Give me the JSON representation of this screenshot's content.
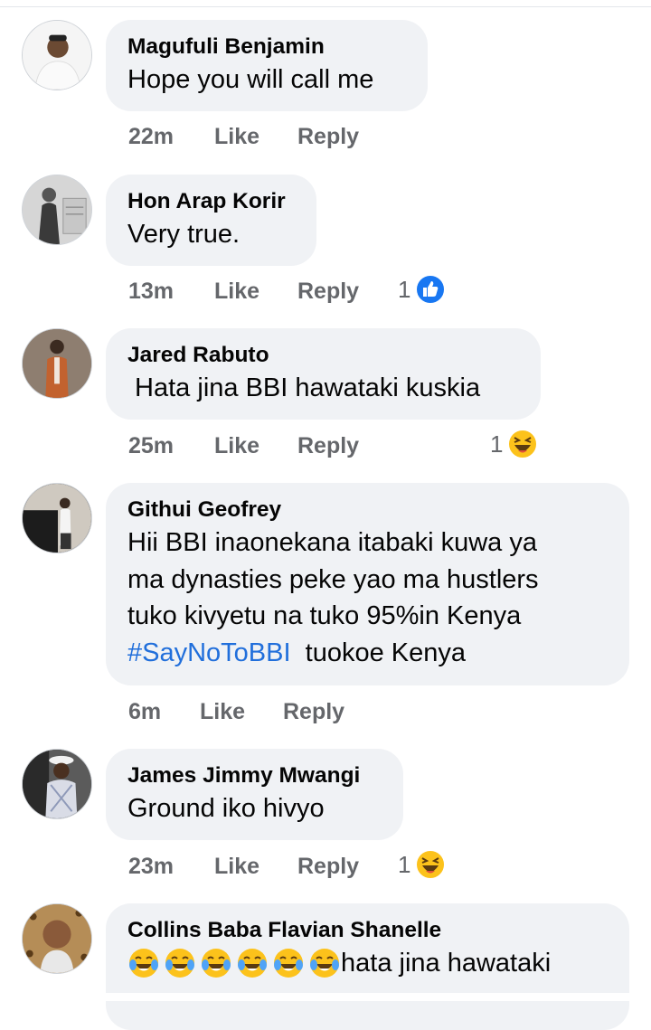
{
  "comments": [
    {
      "author": "Magufuli Benjamin",
      "text": "Hope you will call me",
      "time": "22m",
      "like": "Like",
      "reply": "Reply",
      "reaction_count": "",
      "reaction_icon": ""
    },
    {
      "author": "Hon Arap Korir",
      "text": "Very true.",
      "time": "13m",
      "like": "Like",
      "reply": "Reply",
      "reaction_count": "1",
      "reaction_icon": "like-reaction-icon"
    },
    {
      "author": "Jared Rabuto",
      "text": " Hata jina BBI hawataki kuskia",
      "time": "25m",
      "like": "Like",
      "reply": "Reply",
      "reaction_count": "1",
      "reaction_icon": "haha-reaction-icon"
    },
    {
      "author": "Githui Geofrey",
      "lines": [
        "Hii BBI inaonekana itabaki kuwa ya",
        "ma dynasties peke yao ma hustlers",
        "tuko kivyetu na tuko 95%in Kenya"
      ],
      "hashtag": "#SayNoToBBI",
      "after_hashtag": "  tuokoe Kenya",
      "time": "6m",
      "like": "Like",
      "reply": "Reply"
    },
    {
      "author": "James Jimmy Mwangi",
      "text": "Ground iko hivyo",
      "time": "23m",
      "like": "Like",
      "reply": "Reply",
      "reaction_count": "1",
      "reaction_icon": "haha-reaction-icon"
    },
    {
      "author": "Collins Baba Flavian Shanelle",
      "emoji_icon": "tears-of-joy-emoji",
      "emoji_repeat": 6,
      "text": "hata jina hawataki"
    }
  ],
  "colors": {
    "bubble": "#f0f2f5",
    "meta_text": "#65676b",
    "hashtag": "#216fdb",
    "like_blue": "#1877f2",
    "emoji_yellow": "#fcc21b"
  }
}
